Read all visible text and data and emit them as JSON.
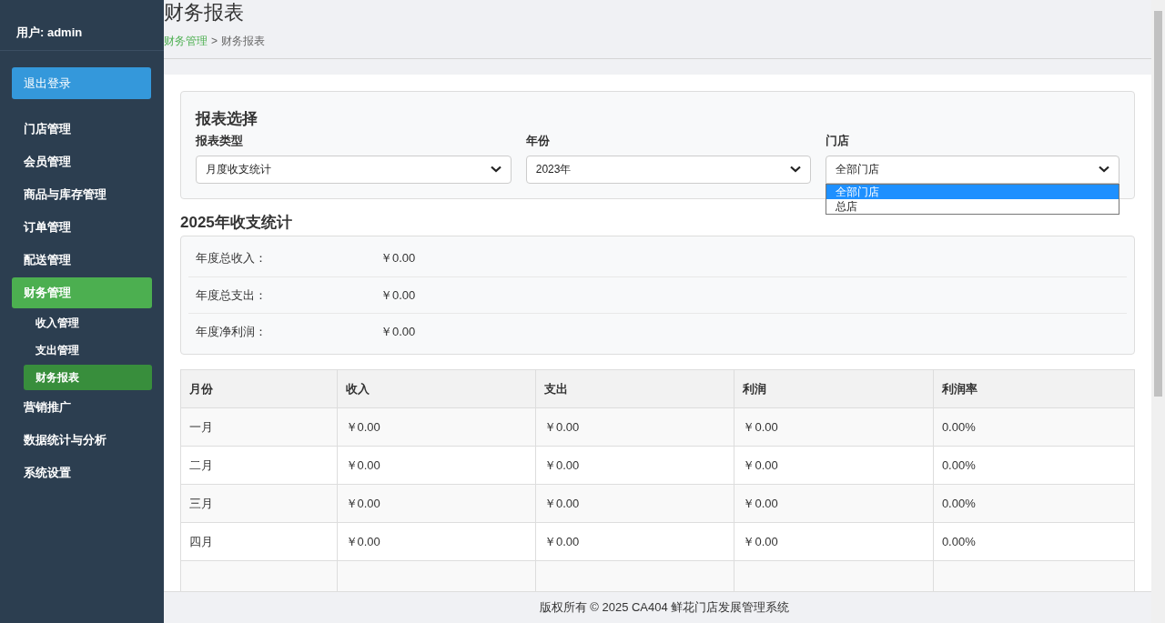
{
  "sidebar": {
    "user": "用户: admin",
    "logout": "退出登录",
    "items": [
      {
        "label": "门店管理",
        "selected": false
      },
      {
        "label": "会员管理",
        "selected": false
      },
      {
        "label": "商品与库存管理",
        "selected": false
      },
      {
        "label": "订单管理",
        "selected": false
      },
      {
        "label": "配送管理",
        "selected": false
      },
      {
        "label": "财务管理",
        "selected": true,
        "children": [
          {
            "label": "收入管理",
            "selected": false
          },
          {
            "label": "支出管理",
            "selected": false
          },
          {
            "label": "财务报表",
            "selected": true
          }
        ]
      },
      {
        "label": "营销推广",
        "selected": false
      },
      {
        "label": "数据统计与分析",
        "selected": false
      },
      {
        "label": "系统设置",
        "selected": false
      }
    ]
  },
  "header": {
    "title": "财务报表",
    "breadcrumb": [
      {
        "label": "财务管理",
        "kind": "link"
      },
      {
        "label": ">",
        "kind": "separator"
      },
      {
        "label": "财务报表",
        "kind": "current"
      }
    ]
  },
  "filters": {
    "title": "报表选择",
    "fields": [
      {
        "label": "报表类型",
        "value": "月度收支统计",
        "expanded": false
      },
      {
        "label": "年份",
        "value": "2023年",
        "expanded": false
      },
      {
        "label": "门店",
        "value": "全部门店",
        "expanded": true,
        "options": [
          {
            "label": "全部门店",
            "selected": true
          },
          {
            "label": "总店",
            "selected": false
          }
        ]
      }
    ]
  },
  "summary": {
    "title": "2025年收支统计",
    "rows": [
      {
        "label": "年度总收入：",
        "value": "￥0.00"
      },
      {
        "label": "年度总支出：",
        "value": "￥0.00"
      },
      {
        "label": "年度净利润：",
        "value": "￥0.00"
      }
    ]
  },
  "table": {
    "columns": [
      "月份",
      "收入",
      "支出",
      "利润",
      "利润率"
    ],
    "rows": [
      [
        "一月",
        "￥0.00",
        "￥0.00",
        "￥0.00",
        "0.00%"
      ],
      [
        "二月",
        "￥0.00",
        "￥0.00",
        "￥0.00",
        "0.00%"
      ],
      [
        "三月",
        "￥0.00",
        "￥0.00",
        "￥0.00",
        "0.00%"
      ],
      [
        "四月",
        "￥0.00",
        "￥0.00",
        "￥0.00",
        "0.00%"
      ]
    ]
  },
  "footer": "版权所有 © 2025 CA404 鲜花门店发展管理系统"
}
